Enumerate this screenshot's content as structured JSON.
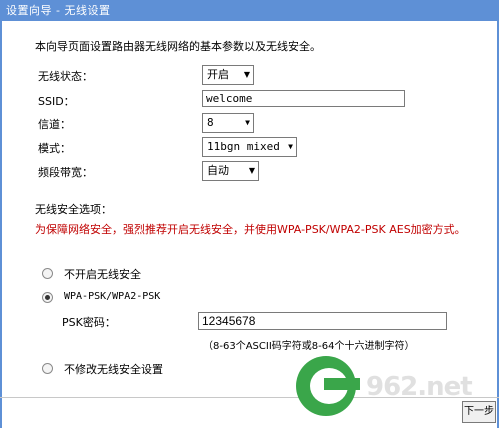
{
  "window": {
    "title": "设置向导 - 无线设置"
  },
  "intro": "本向导页面设置路由器无线网络的基本参数以及无线安全。",
  "fields": {
    "wireless_status": {
      "label": "无线状态：",
      "value": "开启"
    },
    "ssid": {
      "label": "SSID：",
      "value": "welcome"
    },
    "channel": {
      "label": "信道：",
      "value": "8"
    },
    "mode": {
      "label": "模式：",
      "value": "11bgn mixed"
    },
    "bandwidth": {
      "label": "频段带宽：",
      "value": "自动"
    }
  },
  "security": {
    "section_label": "无线安全选项：",
    "warning": "为保障网络安全，强烈推荐开启无线安全，并使用WPA-PSK/WPA2-PSK AES加密方式。",
    "options": [
      {
        "label": "不开启无线安全",
        "selected": false
      },
      {
        "label": "WPA-PSK/WPA2-PSK",
        "selected": true
      },
      {
        "label": "不修改无线安全设置",
        "selected": false
      }
    ],
    "psk_label": "PSK密码：",
    "psk_value": "12345678",
    "psk_hint": "（8-63个ASCII码字符或8-64个十六进制字符）"
  },
  "watermark": {
    "text": "962.net"
  },
  "footer": {
    "button_label": "下一步"
  },
  "colors": {
    "titlebar": "#5e90d6",
    "warning": "#c00000",
    "logo": "#3aa64a"
  }
}
